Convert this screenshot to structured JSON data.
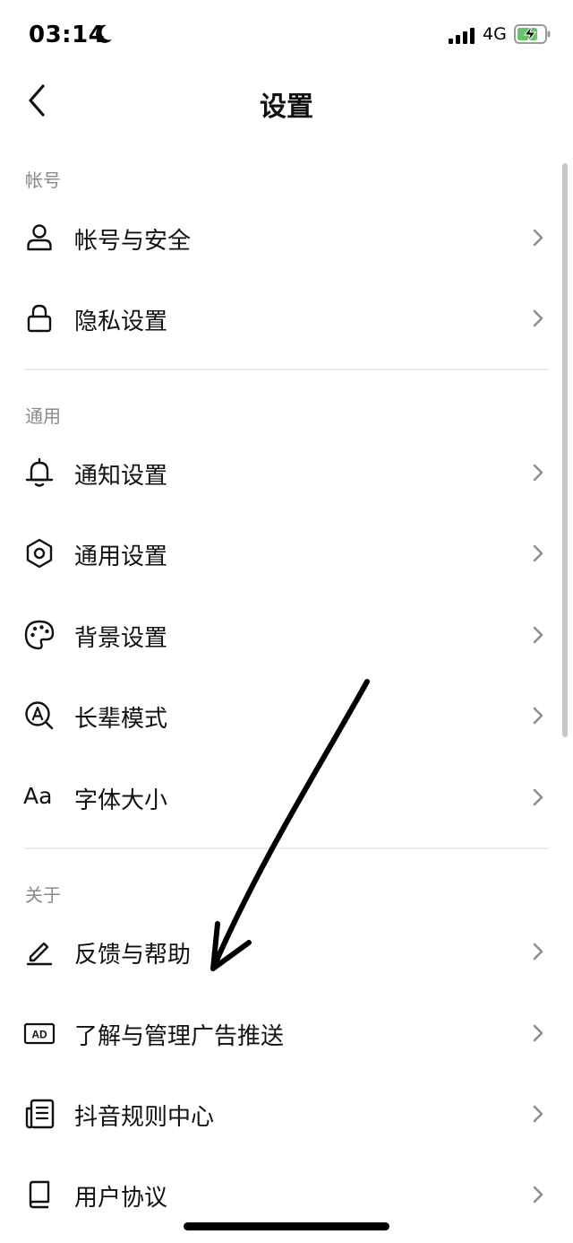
{
  "status_bar": {
    "time": "03:14",
    "network": "4G"
  },
  "nav": {
    "title": "设置"
  },
  "sections": {
    "account": {
      "label": "帐号",
      "items": [
        {
          "label": "帐号与安全",
          "icon": "person-icon"
        },
        {
          "label": "隐私设置",
          "icon": "lock-icon"
        }
      ]
    },
    "general": {
      "label": "通用",
      "items": [
        {
          "label": "通知设置",
          "icon": "bell-icon"
        },
        {
          "label": "通用设置",
          "icon": "gear-icon"
        },
        {
          "label": "背景设置",
          "icon": "palette-icon"
        },
        {
          "label": "长辈模式",
          "icon": "elder-mode-icon"
        },
        {
          "label": "字体大小",
          "icon": "font-size-icon",
          "icon_text": "Aa"
        }
      ]
    },
    "about": {
      "label": "关于",
      "items": [
        {
          "label": "反馈与帮助",
          "icon": "pencil-icon"
        },
        {
          "label": "了解与管理广告推送",
          "icon": "ad-icon",
          "icon_text": "AD"
        },
        {
          "label": "抖音规则中心",
          "icon": "document-icon"
        },
        {
          "label": "用户协议",
          "icon": "book-icon"
        }
      ]
    }
  },
  "colors": {
    "text": "#111111",
    "section_label": "#8a8a8a",
    "divider": "#ececec",
    "chevron": "#8e8e8e",
    "battery_fill": "#65c466"
  }
}
